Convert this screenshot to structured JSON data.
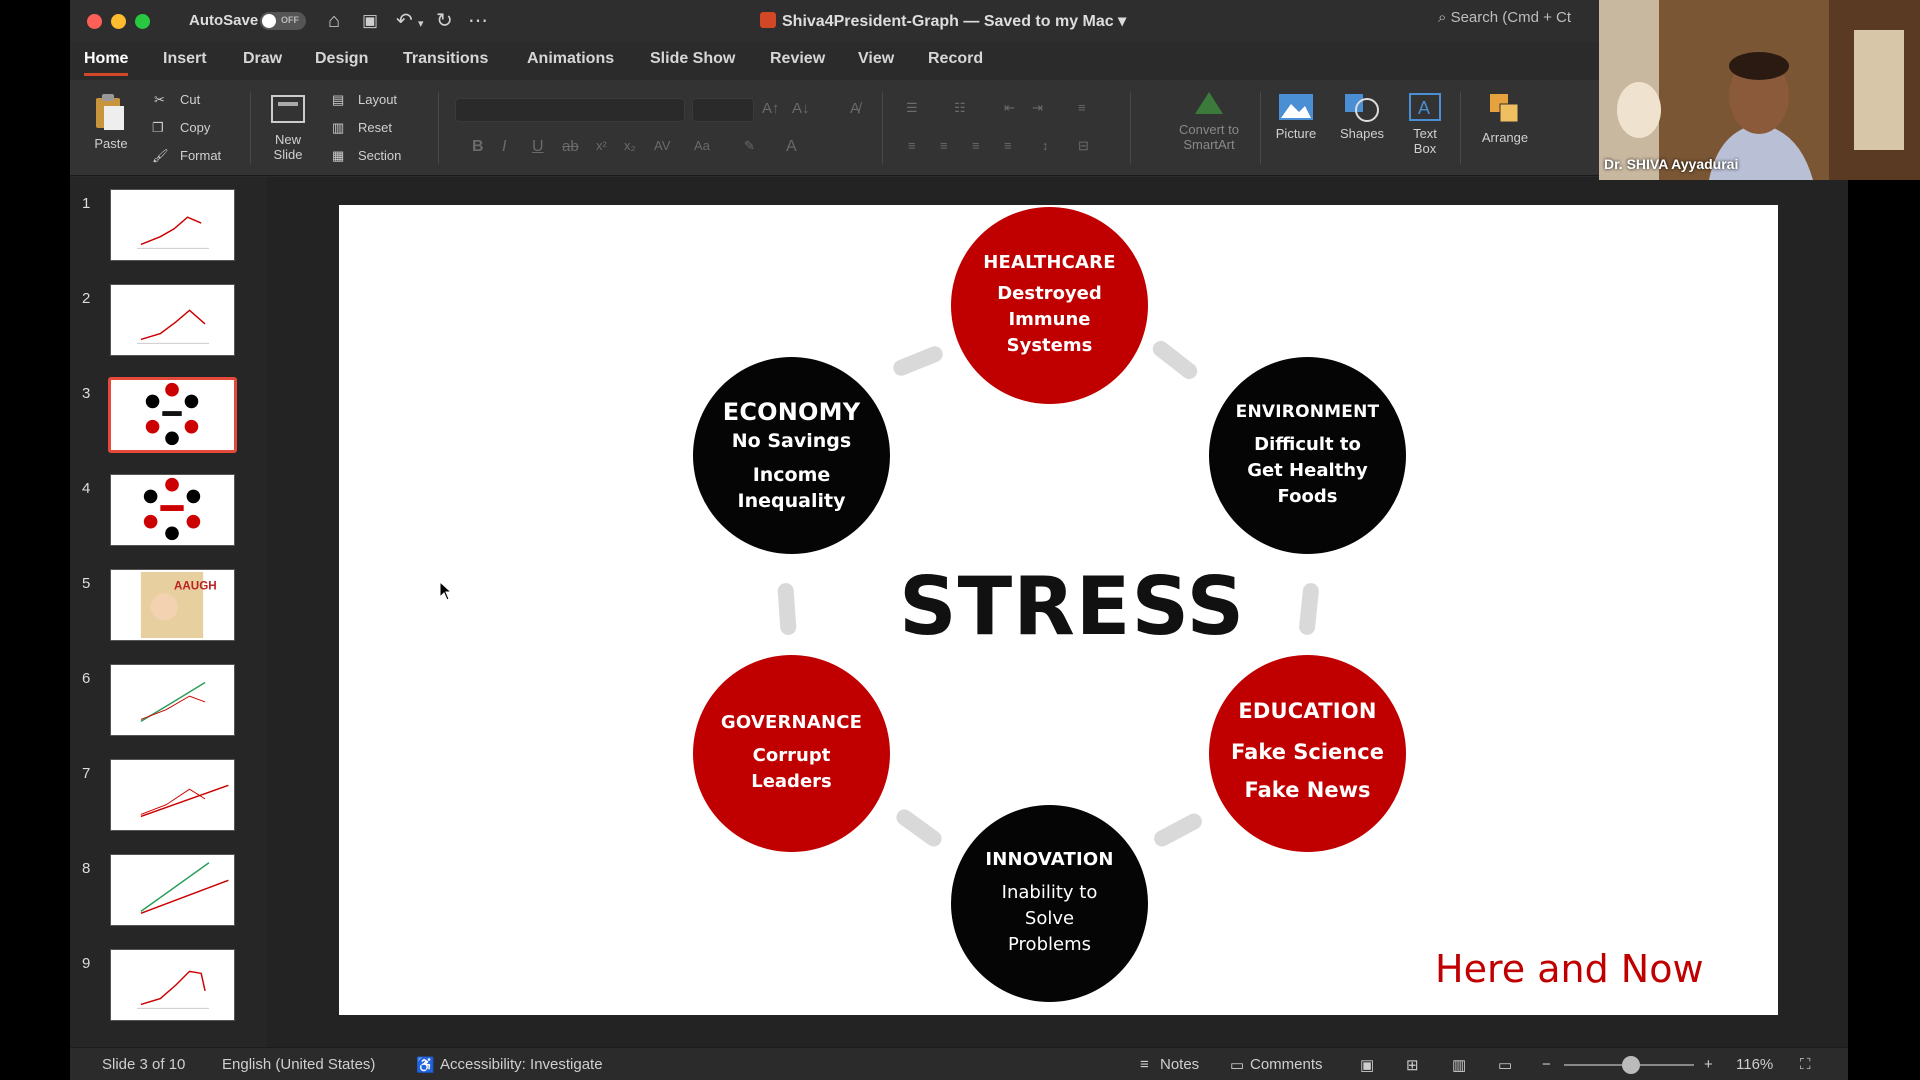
{
  "titlebar": {
    "autosave_label": "AutoSave",
    "autosave_state": "OFF",
    "document_title": "Shiva4President-Graph — Saved to my Mac",
    "search_placeholder": "Search (Cmd + Ct"
  },
  "menu_tabs": [
    "Home",
    "Insert",
    "Draw",
    "Design",
    "Transitions",
    "Animations",
    "Slide Show",
    "Review",
    "View",
    "Record"
  ],
  "ribbon": {
    "paste": "Paste",
    "cut": "Cut",
    "copy": "Copy",
    "format": "Format",
    "new_slide_line1": "New",
    "new_slide_line2": "Slide",
    "layout": "Layout",
    "reset": "Reset",
    "section": "Section",
    "convert_line1": "Convert to",
    "convert_line2": "SmartArt",
    "picture": "Picture",
    "shapes": "Shapes",
    "textbox_line1": "Text",
    "textbox_line2": "Box",
    "arrange": "Arrange"
  },
  "slide_thumbnails": [
    "1",
    "2",
    "3",
    "4",
    "5",
    "6",
    "7",
    "8",
    "9"
  ],
  "selected_slide": 3,
  "slide": {
    "center_text": "STRESS",
    "footer_text": "Here and Now",
    "healthcare": {
      "title": "HEALTHCARE",
      "lines": [
        "Destroyed",
        "Immune",
        "Systems"
      ]
    },
    "environment": {
      "title": "ENVIRONMENT",
      "lines": [
        "Difficult to",
        "Get Healthy",
        "Foods"
      ]
    },
    "education": {
      "title": "EDUCATION",
      "lines": [
        "Fake Science",
        "Fake News"
      ]
    },
    "innovation": {
      "title": "INNOVATION",
      "lines": [
        "Inability to",
        "Solve",
        "Problems"
      ]
    },
    "governance": {
      "title": "GOVERNANCE",
      "lines": [
        "Corrupt",
        "Leaders"
      ]
    },
    "economy": {
      "title": "ECONOMY",
      "lines": [
        "No Savings",
        "Income",
        "Inequality"
      ]
    }
  },
  "statusbar": {
    "slide_info": "Slide 3 of 10",
    "language": "English (United States)",
    "accessibility": "Accessibility: Investigate",
    "notes": "Notes",
    "comments": "Comments",
    "zoom": "116%"
  },
  "webcam": {
    "participant_name": "Dr. SHIVA Ayyadurai"
  },
  "colors": {
    "accent_red": "#c00000",
    "circle_black": "#050505",
    "active_tab_underline": "#d24726"
  }
}
